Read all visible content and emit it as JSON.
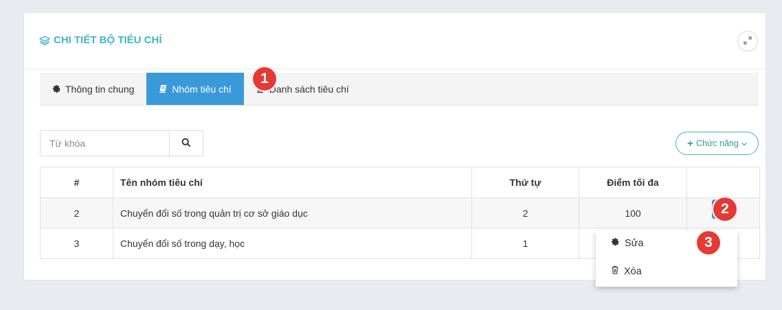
{
  "card": {
    "title": "CHI TIẾT BỘ TIÊU CHÍ"
  },
  "tabs": [
    {
      "label": "Thông tin chung",
      "icon": "gear-icon",
      "active": false
    },
    {
      "label": "Nhóm tiêu chí",
      "icon": "book-icon",
      "active": true
    },
    {
      "label": "Danh sách tiêu chí",
      "icon": "book-icon",
      "active": false
    }
  ],
  "search": {
    "placeholder": "Từ khóa",
    "value": ""
  },
  "toolbar": {
    "function_label": "Chức năng",
    "function_plus": "+",
    "function_caret": "⌄"
  },
  "table": {
    "headers": [
      "#",
      "Tên nhóm tiêu chí",
      "Thứ tự",
      "Điểm tối đa",
      ""
    ],
    "rows": [
      [
        "2",
        "Chuyển đổi số trong quản trị cơ sở giáo dục",
        "2",
        "100"
      ],
      [
        "3",
        "Chuyển đổi số trong dạy, học",
        "1",
        ""
      ]
    ]
  },
  "dropdown": {
    "items": [
      {
        "label": "Sửa",
        "icon": "gear-icon"
      },
      {
        "label": "Xóa",
        "icon": "trash-icon"
      }
    ]
  },
  "annotations": [
    "1",
    "2",
    "3"
  ],
  "colors": {
    "accent_teal": "#3fb5c8",
    "tab_active": "#3a9ad9",
    "badge_red": "#e53935",
    "function_green": "#2e9f92"
  }
}
